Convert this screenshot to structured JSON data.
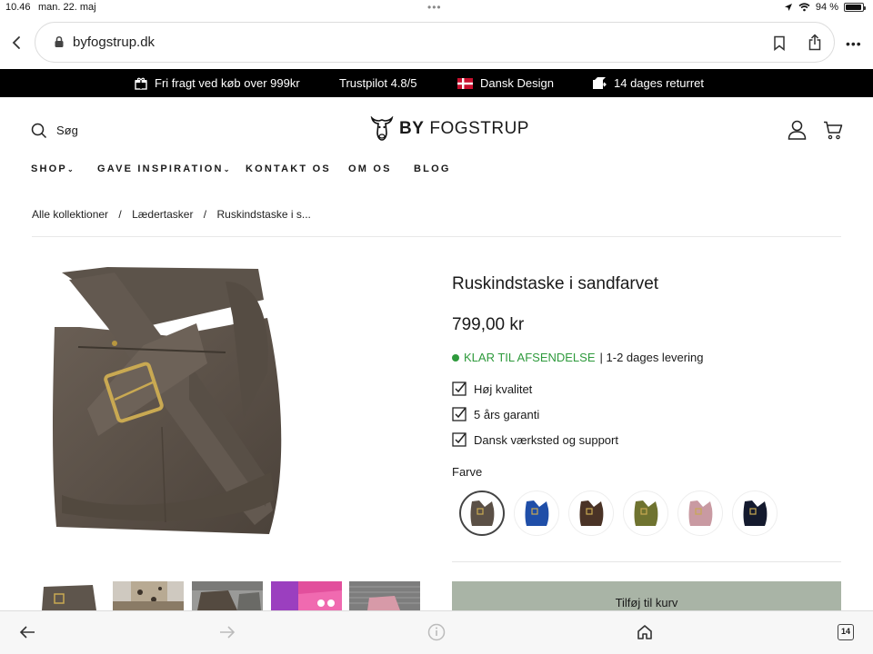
{
  "status_bar": {
    "time": "10.46",
    "date": "man. 22. maj",
    "battery": "94 %",
    "battery_level": 0.94
  },
  "browser": {
    "url": "byfogstrup.dk",
    "tab_count": "14"
  },
  "promo": {
    "items": [
      "Fri fragt ved køb over 999kr",
      "Trustpilot 4.8/5",
      "Dansk Design",
      "14 dages returret"
    ]
  },
  "header": {
    "search_label": "Søg",
    "logo_by": "BY",
    "logo_name": "FOGSTRUP"
  },
  "nav": {
    "items": [
      "SHOP",
      "GAVE INSPIRATION",
      "KONTAKT OS",
      "OM OS",
      "BLOG"
    ]
  },
  "breadcrumb": {
    "items": [
      "Alle kollektioner",
      "Lædertasker",
      "Ruskindstaske i s..."
    ],
    "separator": "/"
  },
  "product": {
    "title": "Ruskindstaske i sandfarvet",
    "price": "799,00 kr",
    "stock_status": "KLAR TIL AFSENDELSE",
    "delivery": "| 1-2 dages levering",
    "features": [
      "Høj kvalitet",
      "5 års garanti",
      "Dansk værksted og support"
    ],
    "color_label": "Farve",
    "colors": [
      {
        "name": "brown-grey",
        "hex": "#5b5046",
        "selected": true
      },
      {
        "name": "blue",
        "hex": "#1f4ea8",
        "selected": false
      },
      {
        "name": "dark-brown",
        "hex": "#4a3326",
        "selected": false
      },
      {
        "name": "olive",
        "hex": "#6f7330",
        "selected": false
      },
      {
        "name": "rose",
        "hex": "#c99aa2",
        "selected": false
      },
      {
        "name": "navy",
        "hex": "#141a2e",
        "selected": false
      }
    ],
    "add_to_cart": "Tilføj til kurv"
  },
  "colors": {
    "promo_bg": "#000000",
    "stock_green": "#2e9a3c",
    "cart_button": "#a9b4a6"
  }
}
